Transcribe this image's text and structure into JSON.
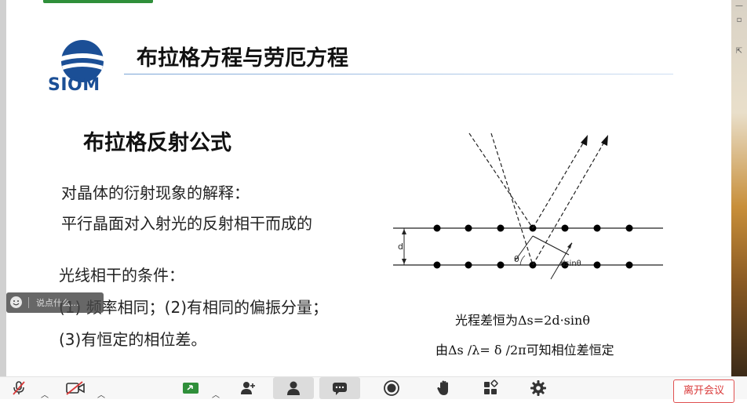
{
  "slide": {
    "logo_text": "SIOM",
    "title": "布拉格方程与劳厄方程",
    "heading": "布拉格反射公式",
    "lines": [
      "对晶体的衍射现象的解释：",
      "平行晶面对入射光的反射相干而成的",
      "光线相干的条件：",
      "(1) 频率相同；(2)有相同的偏振分量；",
      "(3)有恒定的相位差。"
    ],
    "diagram": {
      "d_label": "d",
      "theta_label": "θ",
      "dsin_label": "dsinθ"
    },
    "formula_1": "光程差恒为Δs=2d·sinθ",
    "formula_2": "由Δs /λ= δ /2π可知相位差恒定"
  },
  "chat": {
    "placeholder": "说点什么..."
  },
  "toolbar": {
    "leave_label": "离开会议"
  },
  "colors": {
    "logo_blue": "#1b4f96",
    "leave_red": "#d93a3a",
    "top_accent": "#2f8f3a"
  },
  "icons": [
    "mic-muted-icon",
    "video-off-icon",
    "share-screen-icon",
    "add-participant-icon",
    "participants-icon",
    "chat-icon",
    "record-icon",
    "raise-hand-icon",
    "apps-icon",
    "settings-icon",
    "smile-icon"
  ]
}
